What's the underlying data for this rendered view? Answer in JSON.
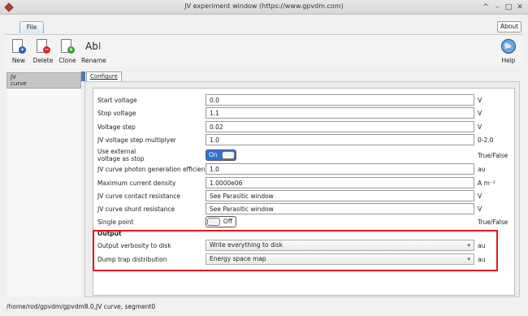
{
  "window": {
    "title": "JV experiment window (https://www.gpvdm.com)",
    "controls": [
      "^",
      "–",
      "□",
      "✕"
    ]
  },
  "menu": {
    "file_tab": "File",
    "about_button": "About"
  },
  "toolbar": {
    "new_label": "New",
    "delete_label": "Delete",
    "clone_label": "Clone",
    "rename_label": "Rename",
    "rename_glyph": "Ab",
    "help_label": "Help"
  },
  "sidebar": {
    "items": [
      {
        "label": "JV\ncurve"
      }
    ]
  },
  "content": {
    "tab_label": "Configure",
    "fields": [
      {
        "label": "Start voltage",
        "value": "0.0",
        "unit": "V"
      },
      {
        "label": "Stop voltage",
        "value": "1.1",
        "unit": "V"
      },
      {
        "label": "Voltage step",
        "value": "0.02",
        "unit": "V"
      },
      {
        "label": "JV voltage step multiplyer",
        "value": "1.0",
        "unit": "0-2.0"
      },
      {
        "label": "Use external\nvoltage as stop",
        "toggle": "On",
        "unit": "True/False"
      },
      {
        "label": "JV curve photon generation efficiency",
        "value": "1.0",
        "unit": "au"
      },
      {
        "label": "Maximum current density",
        "value": "1.0000e06",
        "unit": "A m⁻²"
      },
      {
        "label": "JV curve contact resistance",
        "value": "See Parasitic window",
        "unit": "V"
      },
      {
        "label": "JV curve shunt resistance",
        "value": "See Parasitic window",
        "unit": "V"
      },
      {
        "label": "Single point",
        "toggle": "Off",
        "unit": "True/False"
      }
    ],
    "output": {
      "title": "Output",
      "fields": [
        {
          "label": "Output verbosity to disk",
          "selected": "Write everything to disk",
          "unit": "au"
        },
        {
          "label": "Dump trap distribution",
          "selected": "Energy space map",
          "unit": "au"
        }
      ]
    }
  },
  "status": {
    "path": "/home/rod/gpvdm/gpvdm8.0,JV curve, segment0"
  },
  "colors": {
    "highlight_box": "#e0141e",
    "toggle_on": "#2f6fd8",
    "tab_strip": "#4a78b8"
  },
  "icons": [
    "app-icon",
    "new-doc-icon",
    "delete-doc-icon",
    "clone-doc-icon",
    "rename-icon",
    "help-globe-icon",
    "dropdown-arrow-icon"
  ]
}
